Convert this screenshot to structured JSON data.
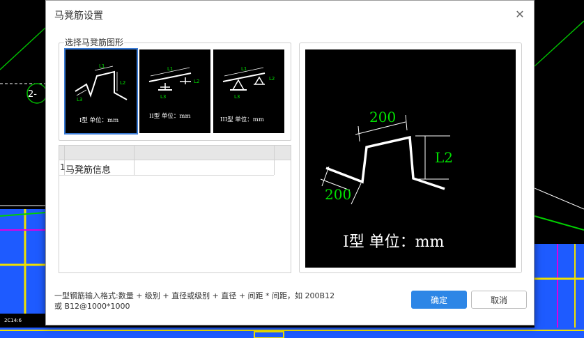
{
  "dialog": {
    "title": "马凳筋设置",
    "close_symbol": "✕"
  },
  "shape_group": {
    "label": "选择马凳筋图形",
    "shapes": [
      {
        "id": "type-1",
        "caption": "I型 单位：mm",
        "l1": "L1",
        "l2": "L2",
        "l3": "L3",
        "selected": true
      },
      {
        "id": "type-2",
        "caption": "II型 单位：mm",
        "l1": "L1",
        "l2": "L2",
        "l3": "L3",
        "selected": false
      },
      {
        "id": "type-3",
        "caption": "III型 单位：mm",
        "l1": "L1",
        "l2": "L2",
        "l3": "L3",
        "selected": false
      }
    ]
  },
  "info_table": {
    "rows": [
      {
        "index": "1",
        "name": "马凳筋信息",
        "value": ""
      }
    ]
  },
  "preview": {
    "top_dim": "200",
    "side_dim": "L2",
    "left_dim": "200",
    "caption": "I型 单位：mm",
    "text_color": "#00e000",
    "line_color": "#ffffff"
  },
  "hint": {
    "line1": "一型钢筋输入格式:数量 + 级别 + 直径或级别 + 直径 + 间距 * 间距，如 200B12",
    "line2": "或 B12@1000*1000"
  },
  "buttons": {
    "ok": "确定",
    "cancel": "取消"
  },
  "colors": {
    "accent": "#2d86e6",
    "cad_blue": "#1e5bff",
    "cad_yellow": "#f0e000",
    "cad_magenta": "#e000e0",
    "cad_green": "#00d000"
  }
}
